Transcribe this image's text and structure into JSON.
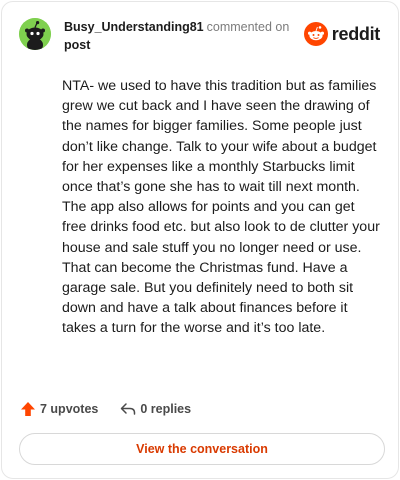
{
  "header": {
    "username": "Busy_Understanding81",
    "commented_on": "commented on",
    "post_link": "post",
    "brand": "reddit"
  },
  "comment": {
    "text": "NTA- we used to have this tradition but as families grew we cut back and I have seen the drawing of the names for bigger families. Some people just don’t like change. Talk to your wife about a budget for her expenses like a monthly Starbucks limit once that’s gone she has to wait till next month. The app also allows for points and you can get free drinks food etc. but also look to de clutter your house and sale stuff you no longer need or use. That can become the Christmas fund. Have a garage sale. But you definitely need to both sit down and have a talk about finances before it takes a turn for the worse and it’s too late."
  },
  "actions": {
    "upvotes": "7 upvotes",
    "replies": "0 replies",
    "view_conversation": "View the conversation"
  },
  "icons": {
    "avatar": "snoo-avatar-icon",
    "logo": "reddit-logo-icon",
    "upvote": "upvote-arrow-icon",
    "reply": "reply-arrow-icon"
  },
  "colors": {
    "brand_orange": "#ff4500",
    "cta_text": "#d93a00",
    "avatar_bg": "#7fd04f"
  }
}
